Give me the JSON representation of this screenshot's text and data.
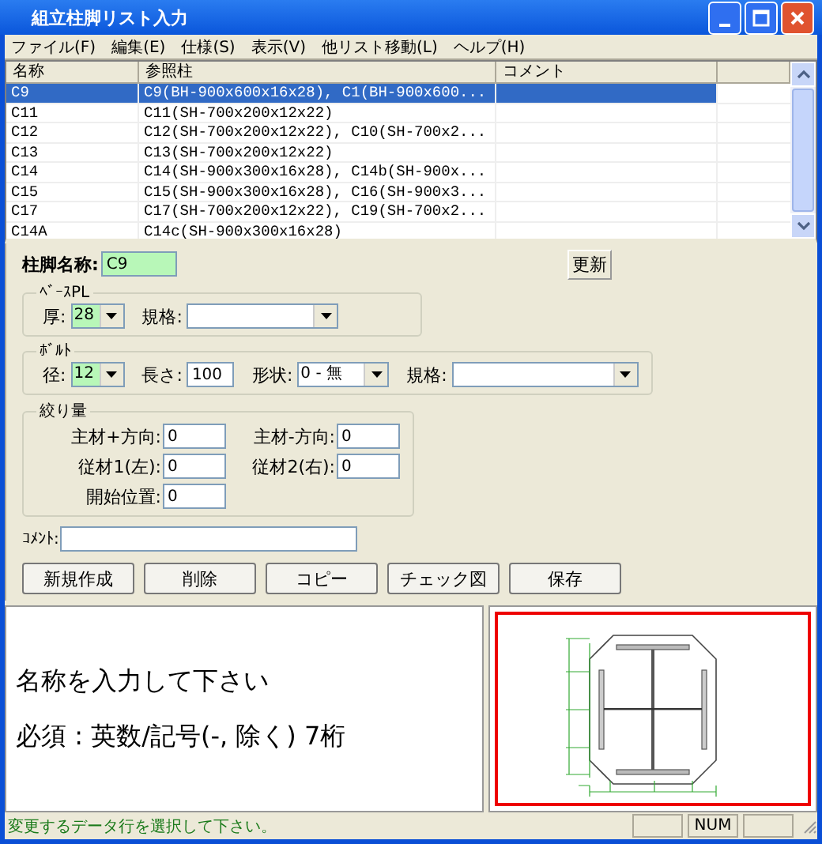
{
  "window": {
    "title": "組立柱脚リスト入力"
  },
  "menu": [
    "ファイル(F)",
    "編集(E)",
    "仕様(S)",
    "表示(V)",
    "他リスト移動(L)",
    "ヘルプ(H)"
  ],
  "table": {
    "columns": [
      "名称",
      "参照柱",
      "コメント"
    ],
    "rows": [
      {
        "name": "C9",
        "ref": "C9(BH-900x600x16x28), C1(BH-900x600...",
        "selected": true
      },
      {
        "name": "C11",
        "ref": "C11(SH-700x200x12x22)",
        "selected": false
      },
      {
        "name": "C12",
        "ref": "C12(SH-700x200x12x22), C10(SH-700x2...",
        "selected": false
      },
      {
        "name": "C13",
        "ref": "C13(SH-700x200x12x22)",
        "selected": false
      },
      {
        "name": "C14",
        "ref": "C14(SH-900x300x16x28), C14b(SH-900x...",
        "selected": false
      },
      {
        "name": "C15",
        "ref": "C15(SH-900x300x16x28), C16(SH-900x3...",
        "selected": false
      },
      {
        "name": "C17",
        "ref": "C17(SH-700x200x12x22), C19(SH-700x2...",
        "selected": false
      },
      {
        "name": "C14A",
        "ref": "C14c(SH-900x300x16x28)",
        "selected": false
      }
    ]
  },
  "form": {
    "name_label": "柱脚名称:",
    "name_value": "C9",
    "name_required": true,
    "update_button": "更新",
    "base_pl": {
      "legend": "ﾍﾞｰｽPL",
      "fields": [
        {
          "label": "厚:",
          "value": "28",
          "required": true
        },
        {
          "label": "規格:",
          "required": false
        }
      ]
    },
    "bolt": {
      "legend": "ﾎﾞﾙﾄ",
      "fields": [
        {
          "kind": "select",
          "label": "径:",
          "value": "12",
          "required": true
        },
        {
          "kind": "input",
          "label": "長さ:",
          "value": "100",
          "required": false
        },
        {
          "kind": "select",
          "label": "形状:",
          "value": "0 - 無",
          "required": false
        },
        {
          "kind": "select",
          "label": "規格:",
          "required": false
        }
      ]
    },
    "shibori": {
      "legend": "絞り量",
      "fields": [
        {
          "label": "主材+方向:",
          "value": "0"
        },
        {
          "label": "主材-方向:",
          "value": "0"
        },
        {
          "label": "従材1(左):",
          "value": "0"
        },
        {
          "label": "従材2(右):",
          "value": "0"
        },
        {
          "label": "開始位置:",
          "value": "0"
        }
      ]
    },
    "comment_label": "ｺﾒﾝﾄ:"
  },
  "buttons": [
    "新規作成",
    "削除",
    "コピー",
    "チェック図",
    "保存"
  ],
  "message": [
    "名称を入力して下さい",
    "必須 : 英数/記号(-, 除く) 7桁"
  ],
  "status_bar": {
    "message": "変更するデータ行を選択して下さい。",
    "indicator": "NUM"
  }
}
